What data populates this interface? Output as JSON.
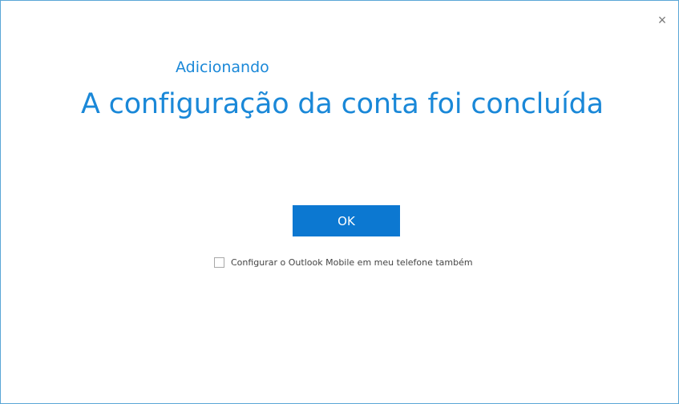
{
  "dialog": {
    "close_glyph": "×",
    "subtitle": "Adicionando",
    "title": "A configuração da conta foi concluída",
    "ok_label": "OK",
    "checkbox": {
      "label": "Configurar o Outlook Mobile em meu telefone também",
      "checked": false
    },
    "colors": {
      "accent_text": "#1a88d8",
      "button_bg": "#0c78d1",
      "border": "#5aa7d6"
    }
  }
}
